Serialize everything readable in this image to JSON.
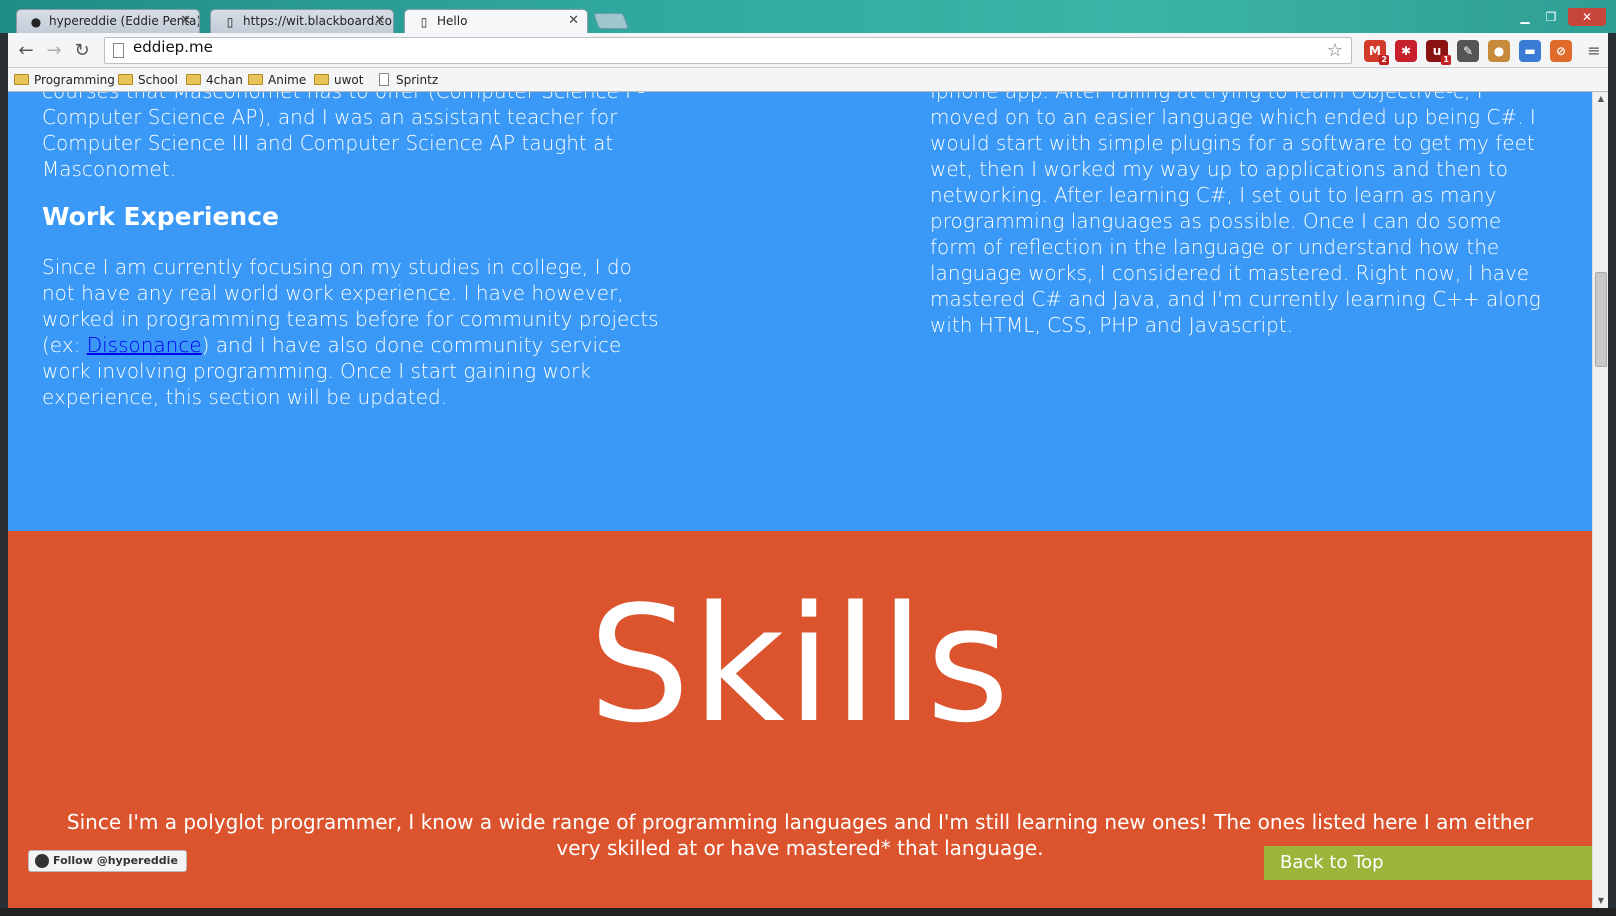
{
  "browser": {
    "tabs": [
      {
        "title": "hypereddie (Eddie Penta)",
        "favicon": "github-icon"
      },
      {
        "title": "https://wit.blackboard.co",
        "favicon": "page-icon"
      },
      {
        "title": "Hello",
        "favicon": "page-icon"
      }
    ],
    "close_glyph": "✕",
    "url": "eddiep.me",
    "extensions": [
      {
        "name": "gmail-icon",
        "badge": "2",
        "color": "#d23a2a"
      },
      {
        "name": "lastpass-icon",
        "badge": "",
        "color": "#c8202c"
      },
      {
        "name": "ublock-icon",
        "badge": "1",
        "color": "#8b1212"
      },
      {
        "name": "eyedropper-icon",
        "badge": "",
        "color": "#555555"
      },
      {
        "name": "cookie-icon",
        "badge": "",
        "color": "#c78a3a"
      },
      {
        "name": "chat-icon",
        "badge": "",
        "color": "#3a7bd5"
      },
      {
        "name": "block-icon",
        "badge": "",
        "color": "#e06a2a"
      }
    ],
    "bookmarks": [
      {
        "label": "Programming",
        "type": "folder"
      },
      {
        "label": "School",
        "type": "folder"
      },
      {
        "label": "4chan",
        "type": "folder"
      },
      {
        "label": "Anime",
        "type": "folder"
      },
      {
        "label": "uwot",
        "type": "folder"
      },
      {
        "label": "Sprintz",
        "type": "file"
      }
    ]
  },
  "page": {
    "education_tail": "courses that Masconomet has to offer (Computer Science I - Computer Science AP), and I was an assistant teacher for Computer Science III and Computer Science AP taught at Masconomet.",
    "work_heading": "Work Experience",
    "work_text_before_link": "Since I am currently focusing on my studies in college, I do not have any real world work experience. I have however, worked in programming teams before for community projects (ex: ",
    "work_link": "Dissonance",
    "work_text_after_link": ") and I have also done community service work involving programming. Once I start gaining work experience, this section will be updated.",
    "right_text": "Iphone app. After failing at trying to learn Objective-c, I moved on to an easier language which ended up being C#. I would start with simple plugins for a software to get my feet wet, then I worked my way up to applications and then to networking. After learning C#, I set out to learn as many programming languages as possible. Once I can do some form of reflection in the language or understand how the language works, I considered it mastered. Right now, I have mastered C# and Java, and I'm currently learning C++ along with HTML, CSS, PHP and Javascript.",
    "skills_title": "Skills",
    "skills_desc": "Since I'm a polyglot programmer, I know a wide range of programming languages and I'm still learning new ones! The ones listed here I am either very skilled at or have mastered* that language.",
    "follow_label": "Follow @hypereddie",
    "back_to_top": "Back to Top",
    "colors": {
      "blue": "#3a98f7",
      "orange": "#dc542d",
      "green": "#9bb43a"
    }
  }
}
